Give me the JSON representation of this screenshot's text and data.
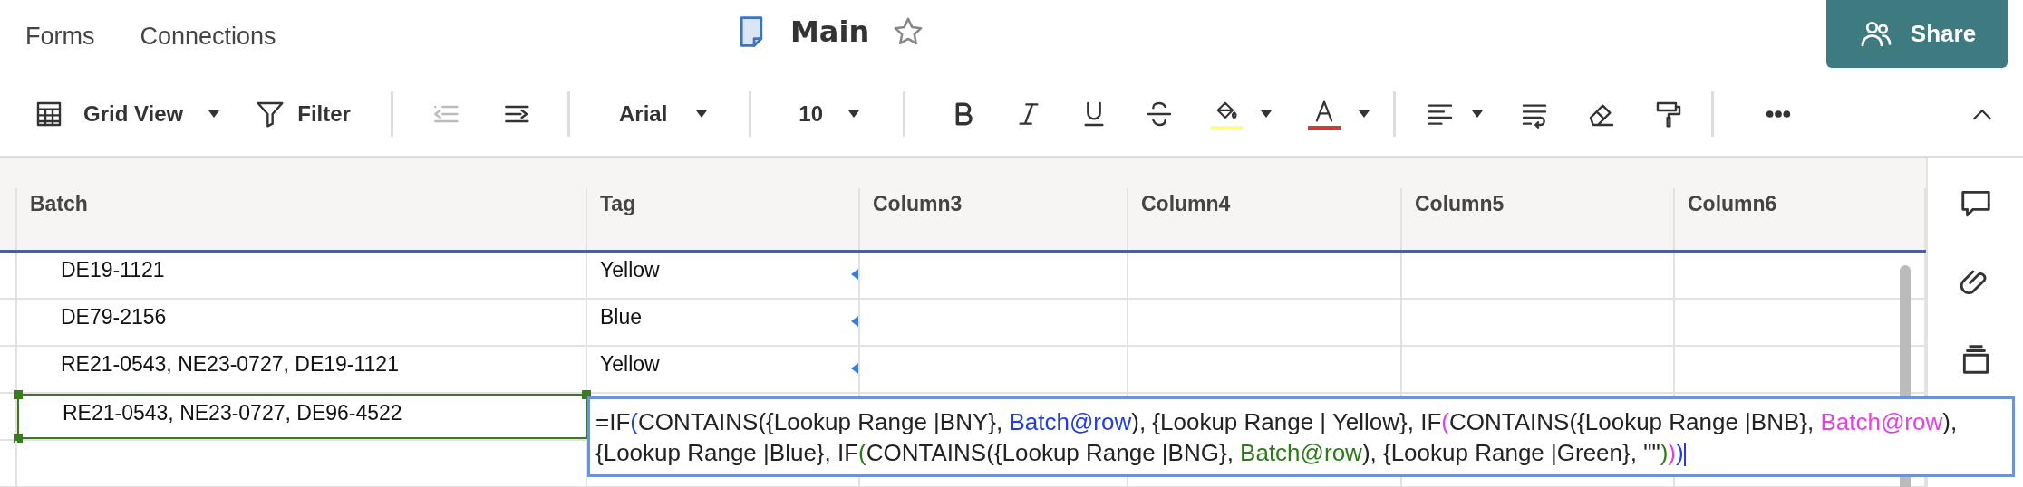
{
  "top_nav": [
    "Forms",
    "Connections"
  ],
  "sheet": {
    "title": "Main",
    "favorite": false
  },
  "share_button": "Share",
  "toolbar": {
    "view_label": "Grid View",
    "filter_label": "Filter",
    "outdent_disabled": true,
    "font": "Arial",
    "font_size": "10"
  },
  "table": {
    "columns": [
      "Batch",
      "Tag",
      "Column3",
      "Column4",
      "Column5",
      "Column6"
    ],
    "rows": [
      {
        "cells": [
          "DE19-1121",
          "Yellow"
        ],
        "selected": false
      },
      {
        "cells": [
          "DE79-2156",
          "Blue"
        ],
        "selected": false
      },
      {
        "cells": [
          "RE21-0543, NE23-0727, DE19-1121",
          "Yellow"
        ],
        "selected": false
      },
      {
        "cells": [
          "RE21-0543, NE23-0727, DE96-4522"
        ],
        "selected": true
      }
    ]
  },
  "formula_editor": {
    "segments": [
      {
        "text": "=IF",
        "color": "#222222"
      },
      {
        "text": "(",
        "color": "#1f3cf0"
      },
      {
        "text": "CONTAINS({Lookup Range |BNY}, ",
        "color": "#222222"
      },
      {
        "text": "Batch@row",
        "color": "#1f3cf0"
      },
      {
        "text": "), {Lookup Range | Yellow}, IF",
        "color": "#222222"
      },
      {
        "text": "(",
        "color": "#e83ee8"
      },
      {
        "text": "CONTAINS({Lookup Range |BNB}, ",
        "color": "#222222"
      },
      {
        "text": "Batch@row",
        "color": "#e83ee8"
      },
      {
        "text": "), {Lookup Range |Blue}, IF",
        "color": "#222222"
      },
      {
        "text": "(",
        "color": "#2e7a18"
      },
      {
        "text": "CONTAINS({Lookup Range |BNG}, ",
        "color": "#222222"
      },
      {
        "text": "Batch@row",
        "color": "#2e7a18"
      },
      {
        "text": "), {Lookup Range |Green}, \"\"",
        "color": "#222222"
      },
      {
        "text": ")",
        "color": "#2e7a18"
      },
      {
        "text": ")",
        "color": "#e83ee8"
      },
      {
        "text": ")",
        "color": "#1f3cf0"
      }
    ]
  }
}
